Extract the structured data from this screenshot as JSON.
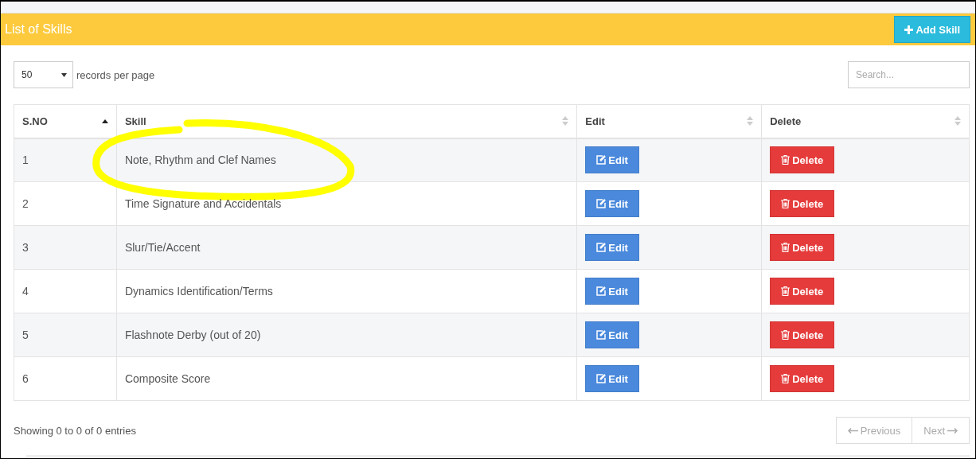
{
  "panel": {
    "title": "List of Skills",
    "add_button": "Add Skill"
  },
  "length_select": {
    "value": "50",
    "label": "records per page"
  },
  "search": {
    "placeholder": "Search..."
  },
  "table": {
    "columns": [
      {
        "label": "S.NO",
        "sorted": true
      },
      {
        "label": "Skill",
        "sorted": false
      },
      {
        "label": "Edit",
        "sorted": false
      },
      {
        "label": "Delete",
        "sorted": false
      }
    ],
    "rows": [
      {
        "no": "1",
        "skill": "Note, Rhythm and Clef Names",
        "edit": "Edit",
        "delete": "Delete",
        "circled": true
      },
      {
        "no": "2",
        "skill": "Time Signature and Accidentals",
        "edit": "Edit",
        "delete": "Delete",
        "circled": false
      },
      {
        "no": "3",
        "skill": "Slur/Tie/Accent",
        "edit": "Edit",
        "delete": "Delete",
        "circled": false
      },
      {
        "no": "4",
        "skill": "Dynamics Identification/Terms",
        "edit": "Edit",
        "delete": "Delete",
        "circled": false
      },
      {
        "no": "5",
        "skill": "Flashnote Derby (out of 20)",
        "edit": "Edit",
        "delete": "Delete",
        "circled": false
      },
      {
        "no": "6",
        "skill": "Composite Score",
        "edit": "Edit",
        "delete": "Delete",
        "circled": false
      }
    ]
  },
  "info": "Showing 0 to 0 of 0 entries",
  "pagination": [
    {
      "label": "Previous",
      "kind": "prev",
      "disabled": true
    },
    {
      "label": "Next",
      "kind": "next",
      "disabled": true
    }
  ]
}
